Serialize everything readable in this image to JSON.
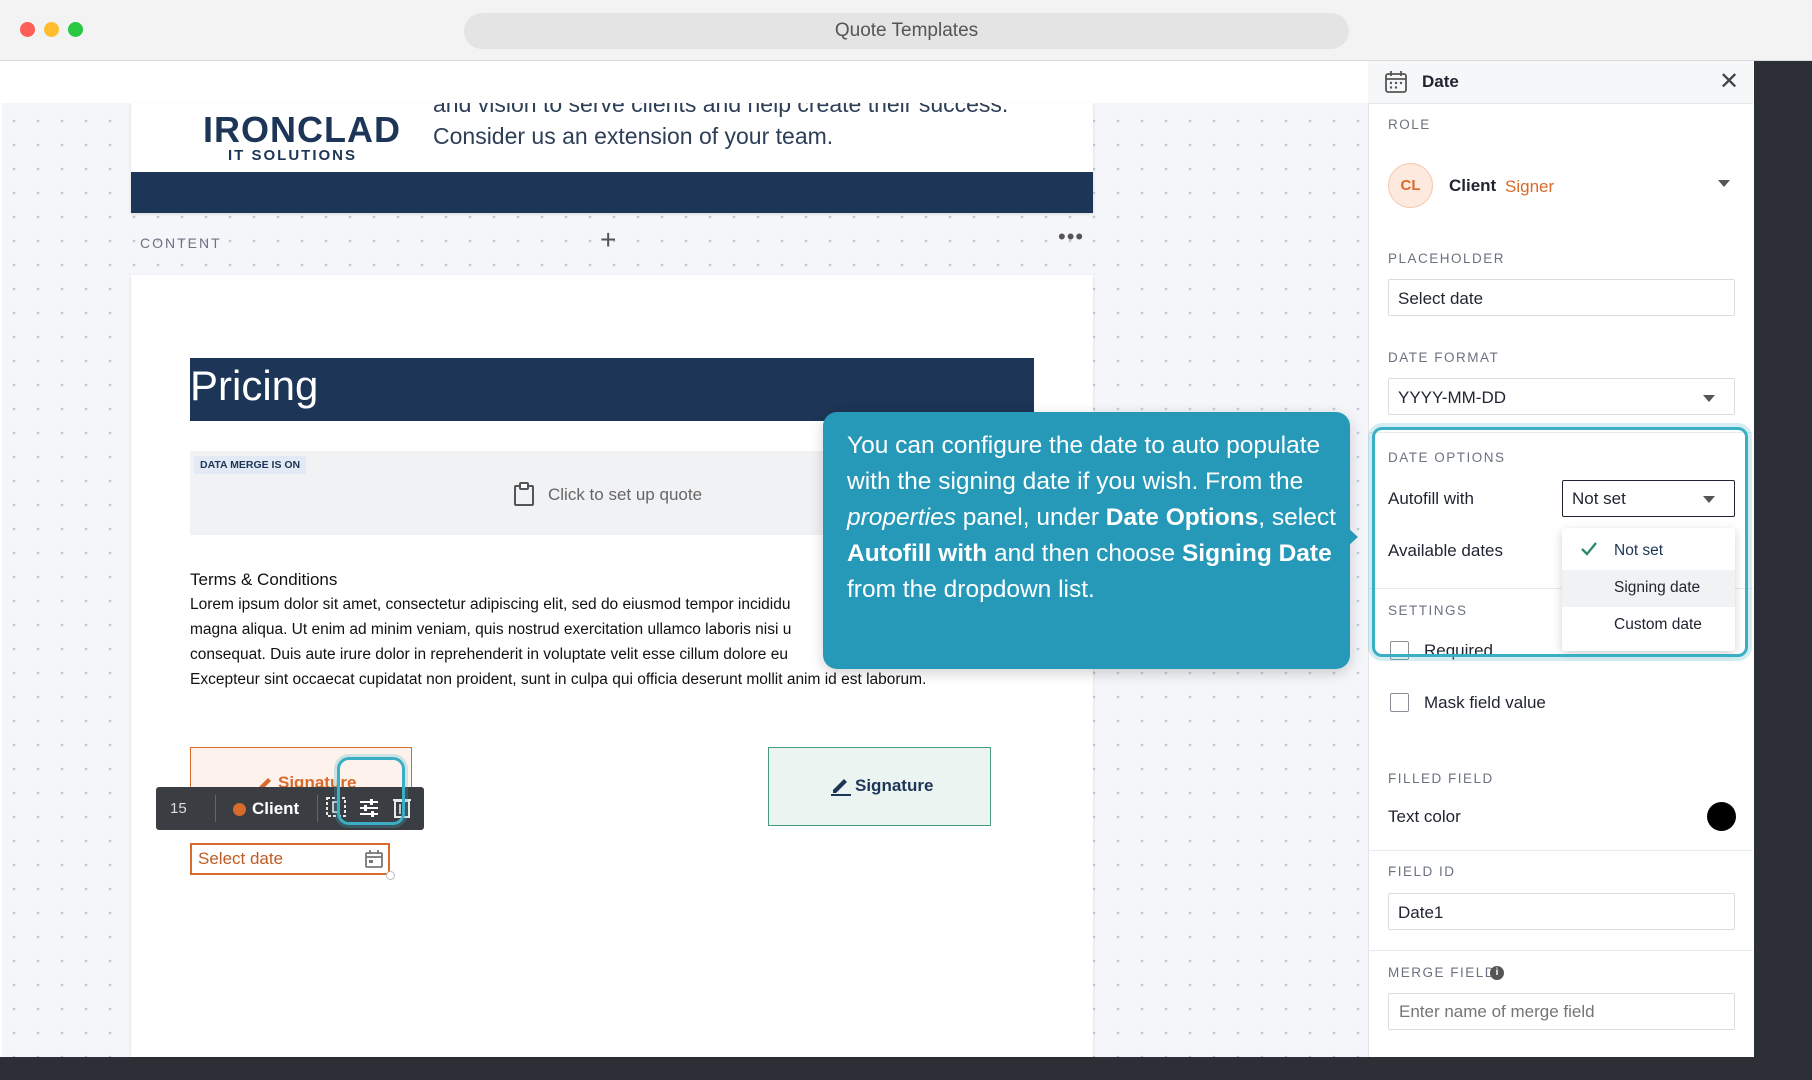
{
  "window": {
    "title": "Quote Templates"
  },
  "header": {
    "logo_main": "IRONCLAD",
    "logo_sub": "IT SOLUTIONS",
    "line1": "and vision to serve clients and help create their success.",
    "line2": "Consider us an extension of your team."
  },
  "section": {
    "label": "CONTENT",
    "add": "+",
    "more": "•••"
  },
  "document": {
    "pricing_title": "Pricing",
    "merge_badge": "DATA MERGE IS ON",
    "quote_cta": "Click to set up quote",
    "terms_title": "Terms & Conditions",
    "terms_lines": [
      "Lorem ipsum dolor sit amet, consectetur adipiscing elit, sed do eiusmod tempor incididu",
      "magna aliqua. Ut enim ad minim veniam, quis nostrud exercitation ullamco laboris nisi u",
      "consequat. Duis aute irure dolor in reprehenderit in voluptate velit esse cillum dolore eu",
      "Excepteur sint occaecat cupidatat non proident, sunt in culpa qui officia deserunt mollit anim id est laborum."
    ],
    "signature_1": "Signature",
    "signature_2": "Signature",
    "date_placeholder": "Select date"
  },
  "field_toolbar": {
    "page_number": "15",
    "role": "Client"
  },
  "tooltip": {
    "t1": "You can configure the date to auto populate with the signing date if you wish. From the ",
    "t2": "properties",
    "t3": " panel, under ",
    "t4": "Date Options",
    "t5": ", select ",
    "t6": "Autofill with",
    "t7": " and then choose ",
    "t8": "Signing Date",
    "t9": " from the dropdown list."
  },
  "panel": {
    "title": "Date",
    "role_label": "ROLE",
    "role_initials": "CL",
    "role_name": "Client",
    "role_type": "Signer",
    "placeholder_label": "PLACEHOLDER",
    "placeholder_value": "Select date",
    "date_format_label": "DATE FORMAT",
    "date_format_value": "YYYY-MM-DD",
    "date_options_label": "DATE OPTIONS",
    "autofill_label": "Autofill with",
    "autofill_value": "Not set",
    "autofill_options": [
      "Not set",
      "Signing date",
      "Custom date"
    ],
    "available_dates_label": "Available dates",
    "settings_label": "SETTINGS",
    "required_label": "Required",
    "mask_label": "Mask field value",
    "filled_field_label": "FILLED FIELD",
    "text_color_label": "Text color",
    "field_id_label": "FIELD ID",
    "field_id_value": "Date1",
    "merge_field_label": "MERGE FIELD",
    "merge_field_placeholder": "Enter name of merge field"
  },
  "colors": {
    "navy": "#1d3556",
    "accent_orange": "#d86a2b",
    "tooltip_blue": "#2799b8",
    "highlight_teal": "#3aaec4",
    "check_green": "#2e8b6a"
  }
}
